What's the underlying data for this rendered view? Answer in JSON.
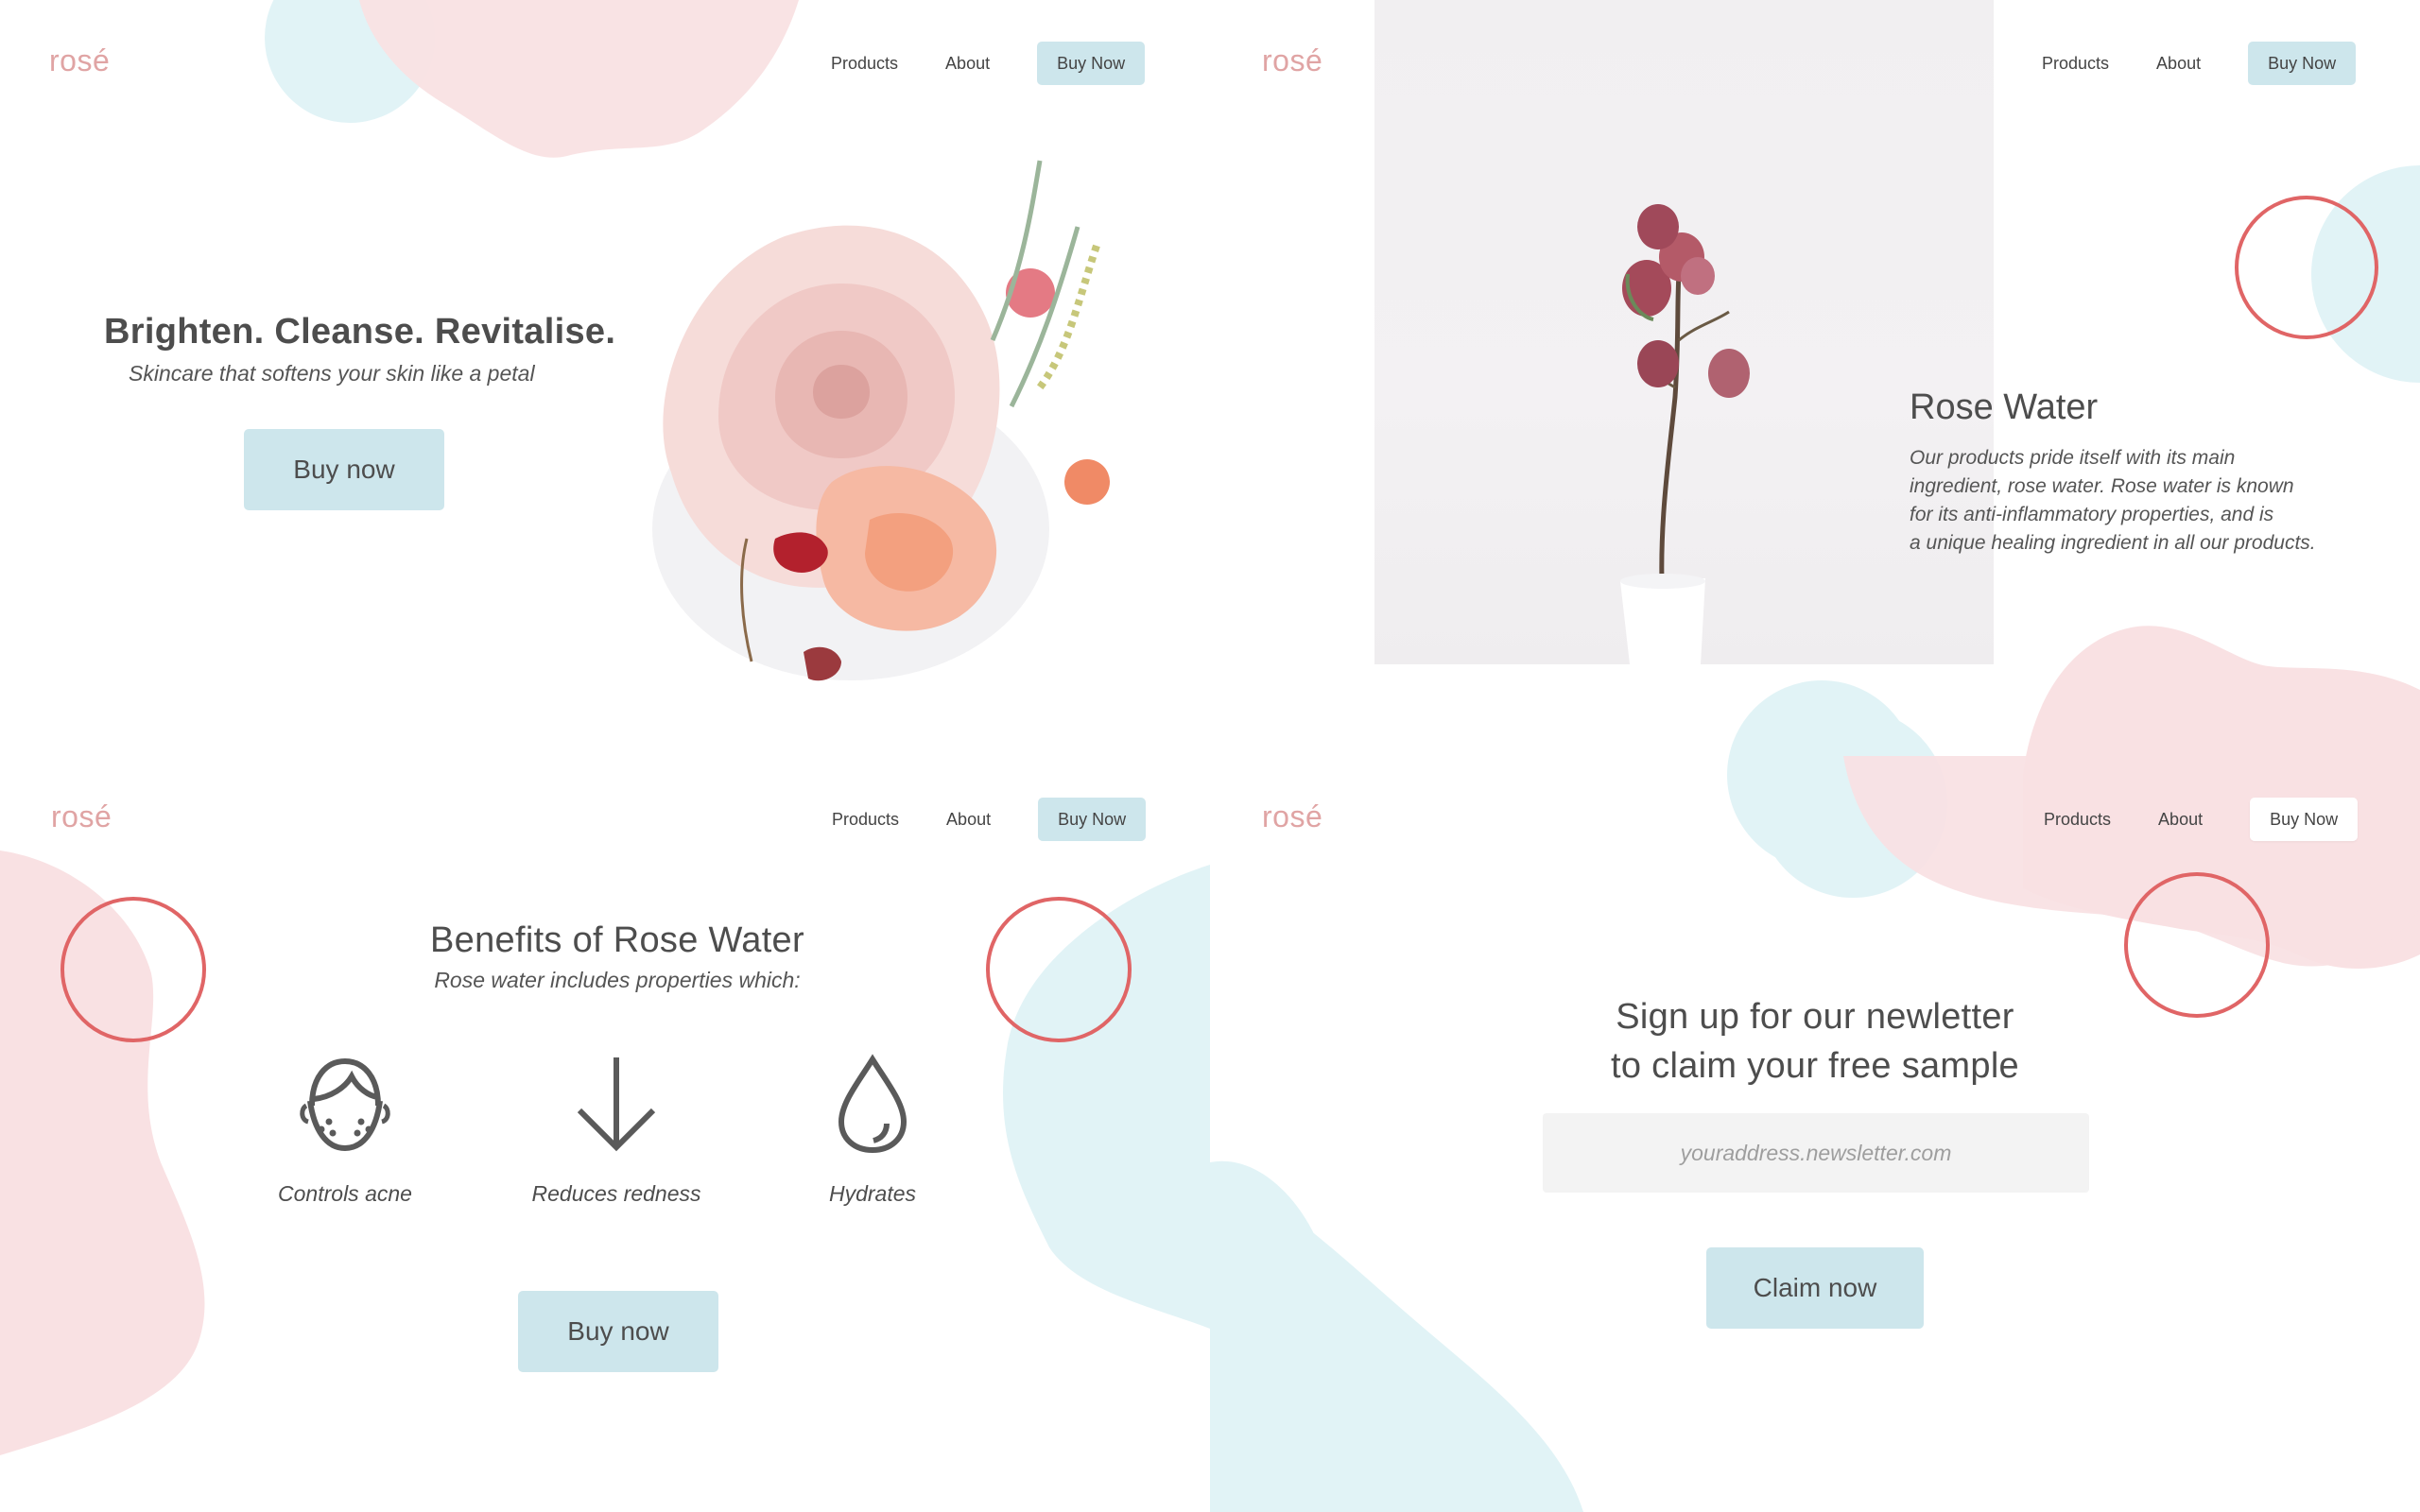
{
  "colors": {
    "accent_blue": "#cde6ec",
    "blob_pink": "#f9e1e3",
    "blob_blue": "#e1f3f6",
    "ring_red": "#e06566",
    "logo_pink": "#e0a4a4",
    "text": "#4d4d4d"
  },
  "screens": {
    "hero": {
      "logo": "rosé",
      "nav": {
        "products": "Products",
        "about": "About",
        "buy": "Buy Now"
      },
      "title": "Brighten. Cleanse. Revitalise.",
      "subtitle": "Skincare that softens your skin like a petal",
      "cta": "Buy now",
      "image_icon": "rose-bouquet-photo"
    },
    "rosewater": {
      "logo": "rosé",
      "nav": {
        "products": "Products",
        "about": "About",
        "buy": "Buy Now"
      },
      "title": "Rose Water",
      "lines": [
        "Our products pride itself with its main",
        "ingredient, rose water. Rose water is known",
        "for its anti-inflammatory properties, and is",
        "a unique healing ingredient in all our products."
      ],
      "image_icon": "dried-rose-vase-photo"
    },
    "benefits": {
      "logo": "rosé",
      "nav": {
        "products": "Products",
        "about": "About",
        "buy": "Buy Now"
      },
      "title": "Benefits of Rose Water",
      "subtitle": "Rose water includes properties which:",
      "items": [
        {
          "icon": "face-icon",
          "label": "Controls acne"
        },
        {
          "icon": "arrow-down-icon",
          "label": "Reduces redness"
        },
        {
          "icon": "water-drop-icon",
          "label": "Hydrates"
        }
      ],
      "cta": "Buy now"
    },
    "newsletter": {
      "logo": "rosé",
      "nav": {
        "products": "Products",
        "about": "About",
        "buy": "Buy Now"
      },
      "title_line1": "Sign up for our newletter",
      "title_line2": "to claim your free sample",
      "email_placeholder": "youraddress.newsletter.com",
      "cta": "Claim now"
    }
  }
}
